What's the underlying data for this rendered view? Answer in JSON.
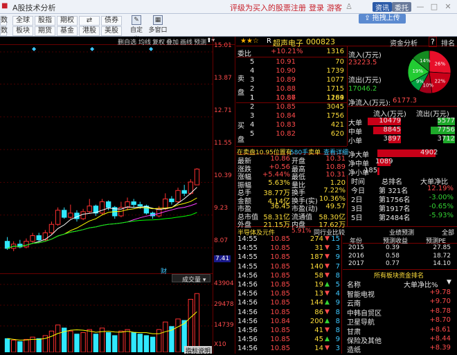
{
  "titlebar": {
    "title": "A股技术分析",
    "promo": "评级为买入的股票",
    "register": "注册",
    "login": "登录",
    "guest": "游客",
    "news": "资讯",
    "entrust": "委托"
  },
  "toolbar": {
    "row1": [
      "全球",
      "股指",
      "期权",
      "债券"
    ],
    "row2": [
      "板块",
      "期货",
      "基金",
      "港股",
      "美股"
    ],
    "extra1": "自定义",
    "extra2": "多窗口",
    "drag_upload": "拖拽上传",
    "row1_left": "数",
    "row2_left": "数"
  },
  "chart_controls": [
    "删自选",
    "均线",
    "复权",
    "叠加",
    "画线",
    "预测"
  ],
  "price_ticks": [
    "15.01",
    "13.87",
    "12.71",
    "11.55",
    "10.39",
    "9.23",
    "8.07",
    "7.41"
  ],
  "volume": {
    "label": "成交量",
    "ticks": [
      "43904",
      "29478",
      "14739",
      "X10"
    ],
    "button": "指标说明",
    "indicator": "财"
  },
  "stock": {
    "stars": "★★☆",
    "prefix": "R",
    "name": "超声电子",
    "code": "000823",
    "tab": "资金分析",
    "rank_tab": "排名"
  },
  "orderbook": {
    "wb_label": "委比",
    "wb": "+10.21%",
    "wb_val": "1316",
    "sell_label": [
      "卖",
      "盘"
    ],
    "buy_label": [
      "买",
      "盘"
    ],
    "sell": [
      [
        "5",
        "10.91",
        "70"
      ],
      [
        "4",
        "10.90",
        "1739"
      ],
      [
        "3",
        "10.89",
        "1077"
      ],
      [
        "2",
        "10.88",
        "1715"
      ],
      [
        "1",
        "10.87",
        "1189"
      ]
    ],
    "buy": [
      [
        "1",
        "10.86",
        "1264"
      ],
      [
        "2",
        "10.85",
        "3045"
      ],
      [
        "3",
        "10.84",
        "1756"
      ],
      [
        "4",
        "10.83",
        "421"
      ],
      [
        "5",
        "10.82",
        "620"
      ]
    ]
  },
  "fund_flow": {
    "in_label": "流入(万元)",
    "in_val": "23223.5",
    "out_label": "流出(万元)",
    "out_val": "17046.2",
    "net_label": "净流入(万元):",
    "net_val": "6177.3",
    "pie": [
      {
        "label": "26%",
        "value": 26,
        "color": "#e8102a"
      },
      {
        "label": "22%",
        "value": 22,
        "color": "#c80018"
      },
      {
        "label": "10%",
        "value": 10,
        "color": "#a0001a"
      },
      {
        "label": "9%",
        "value": 9,
        "color": "#00a040"
      },
      {
        "label": "19%",
        "value": 19,
        "color": "#22cc33"
      },
      {
        "label": "14%",
        "value": 14,
        "color": "#148a20"
      }
    ],
    "table_head": [
      "流入(万元)",
      "流出(万元)"
    ],
    "rows": [
      [
        "大单",
        "10479",
        "5577"
      ],
      [
        "中单",
        "8845",
        "7756"
      ],
      [
        "小单",
        "3897",
        "3712"
      ]
    ]
  },
  "net_bars": [
    [
      "净大单",
      "4902"
    ],
    [
      "净中单",
      "1089"
    ],
    [
      "净小单",
      "185"
    ]
  ],
  "sell_notice": {
    "pos": "在卖盘10.95位置有",
    "size": "580手",
    "label": "卖单",
    "link": "查看详细"
  },
  "quote": [
    [
      "最新",
      "10.86",
      "开盘",
      "10.31"
    ],
    [
      "涨跌",
      "+0.56",
      "最高",
      "10.89"
    ],
    [
      "涨幅",
      "+5.44%",
      "最低",
      "10.31"
    ],
    [
      "振幅",
      "5.63%",
      "量比",
      "1.20"
    ],
    [
      "总手",
      "38.77万",
      "换手",
      "7.22%"
    ],
    [
      "金额",
      "4.14亿",
      "换手(实)",
      "10.36%"
    ],
    [
      "市盈",
      "36.45",
      "市盈(动)",
      "49.57"
    ],
    [
      "总市值",
      "58.31亿",
      "流通值",
      "58.30亿"
    ],
    [
      "外盘",
      "21.15万",
      "内盘",
      "17.62万"
    ]
  ],
  "rank_table": {
    "head": [
      "时间",
      "总排名",
      "大单净比"
    ],
    "rows": [
      [
        "今日",
        "第 321名",
        "12.19%"
      ],
      [
        "2日",
        "第1756名",
        "-3.00%"
      ],
      [
        "3日",
        "第1917名",
        "-0.65%"
      ],
      [
        "5日",
        "第2484名",
        "-5.93%"
      ]
    ]
  },
  "industry": {
    "name": "半导体及元件",
    "pct": "5.91%",
    "compare": "同行业比较"
  },
  "forecast": {
    "title": "业绩预测",
    "tab": "全部",
    "head": [
      "年份",
      "预测收益",
      "预测PE"
    ],
    "rows": [
      [
        "2015",
        "0.39",
        "27.85"
      ],
      [
        "2016",
        "0.58",
        "18.72"
      ],
      [
        "2017",
        "0.77",
        "14.10"
      ]
    ]
  },
  "ticks": [
    [
      "14:55",
      "10.85",
      "274",
      "down",
      "15"
    ],
    [
      "14:55",
      "10.85",
      "31",
      "down",
      "3"
    ],
    [
      "14:55",
      "10.85",
      "187",
      "down",
      "9"
    ],
    [
      "14:55",
      "10.85",
      "140",
      "down",
      "7"
    ],
    [
      "14:56",
      "10.85",
      "58",
      "down",
      "8"
    ],
    [
      "14:56",
      "10.85",
      "19",
      "up",
      "5"
    ],
    [
      "14:56",
      "10.85",
      "13",
      "down",
      "4"
    ],
    [
      "14:56",
      "10.85",
      "144",
      "up",
      "9"
    ],
    [
      "14:56",
      "10.85",
      "86",
      "down",
      "8"
    ],
    [
      "14:56",
      "10.84",
      "200",
      "up",
      "8"
    ],
    [
      "14:56",
      "10.85",
      "41",
      "down",
      "8"
    ],
    [
      "14:56",
      "10.85",
      "45",
      "up",
      "9"
    ],
    [
      "14:56",
      "10.85",
      "14",
      "down",
      "3"
    ]
  ],
  "sector_rank": {
    "title": "所有板块资金排名",
    "head": [
      "名称",
      "大单净比%"
    ],
    "rows": [
      [
        "智能电视",
        "+9.78"
      ],
      [
        "云南",
        "+9.70"
      ],
      [
        "中韩自贸区",
        "+8.78"
      ],
      [
        "卫星导航",
        "+8.70"
      ],
      [
        "甘肃",
        "+8.61"
      ],
      [
        "保险及其他",
        "+8.44"
      ],
      [
        "造纸",
        "+8.39"
      ]
    ]
  },
  "chart_data": {
    "type": "candlestick",
    "candles": [
      [
        8.3,
        8.05,
        8.45,
        8.0
      ],
      [
        8.05,
        8.2,
        8.3,
        7.95
      ],
      [
        8.2,
        8.1,
        8.35,
        8.05
      ],
      [
        8.1,
        8.3,
        8.4,
        8.05
      ],
      [
        8.3,
        8.5,
        8.6,
        8.25
      ],
      [
        8.5,
        8.35,
        8.6,
        8.3
      ],
      [
        8.35,
        8.6,
        8.7,
        8.3
      ],
      [
        8.6,
        8.9,
        9.0,
        8.55
      ],
      [
        8.9,
        9.4,
        9.5,
        8.85
      ],
      [
        9.4,
        9.15,
        9.5,
        9.1
      ],
      [
        9.15,
        9.3,
        9.6,
        9.1
      ],
      [
        9.3,
        9.1,
        9.4,
        9.0
      ],
      [
        9.1,
        9.35,
        9.45,
        9.05
      ],
      [
        9.35,
        9.55,
        9.8,
        9.3
      ],
      [
        9.55,
        9.3,
        9.6,
        9.2
      ],
      [
        9.3,
        9.7,
        9.8,
        9.25
      ],
      [
        9.7,
        9.5,
        9.75,
        9.4
      ],
      [
        9.5,
        9.2,
        9.55,
        9.1
      ],
      [
        9.2,
        9.5,
        9.7,
        9.15
      ],
      [
        9.5,
        9.7,
        9.85,
        9.4
      ],
      [
        9.7,
        9.6,
        9.8,
        9.5
      ],
      [
        9.6,
        9.55,
        9.7,
        9.45
      ],
      [
        9.55,
        9.3,
        9.6,
        9.25
      ],
      [
        9.3,
        9.2,
        9.35,
        9.1
      ],
      [
        9.2,
        9.45,
        9.55,
        9.15
      ],
      [
        9.45,
        9.8,
        10.0,
        9.4
      ],
      [
        9.8,
        9.7,
        9.9,
        9.6
      ],
      [
        9.7,
        10.1,
        10.2,
        9.65
      ],
      [
        10.1,
        10.0,
        10.3,
        9.9
      ],
      [
        10.0,
        10.4,
        10.5,
        9.95
      ],
      [
        10.3,
        10.86,
        10.89,
        10.31
      ]
    ],
    "volumes": [
      9000,
      8000,
      7000,
      8500,
      10000,
      9000,
      11000,
      14000,
      18000,
      16000,
      14000,
      12000,
      13000,
      15000,
      12000,
      16000,
      13000,
      11000,
      14000,
      15000,
      13000,
      12000,
      11000,
      10000,
      15000,
      20000,
      17000,
      22000,
      21000,
      35000,
      38770
    ],
    "ma": [
      {
        "name": "MA5",
        "color": "#ffffff"
      },
      {
        "name": "MA10",
        "color": "#ffff00"
      },
      {
        "name": "MA20",
        "color": "#ff40ff"
      },
      {
        "name": "MA60",
        "color": "#00ff00"
      }
    ]
  }
}
